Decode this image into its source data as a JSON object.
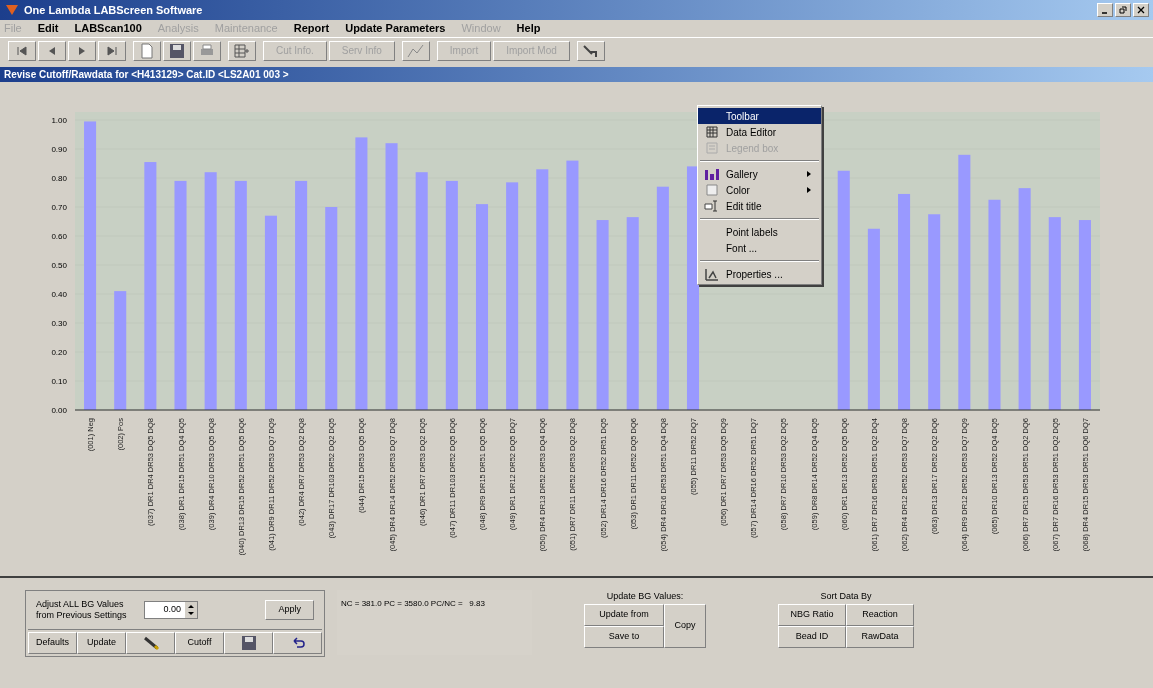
{
  "window": {
    "title": "One Lambda LABScreen Software"
  },
  "menu": [
    {
      "label": "File",
      "disabled": true
    },
    {
      "label": "Edit",
      "disabled": false
    },
    {
      "label": "LABScan100",
      "disabled": false
    },
    {
      "label": "Analysis",
      "disabled": true
    },
    {
      "label": "Maintenance",
      "disabled": true
    },
    {
      "label": "Report",
      "disabled": false
    },
    {
      "label": "Update Parameters",
      "disabled": false
    },
    {
      "label": "Window",
      "disabled": true
    },
    {
      "label": "Help",
      "disabled": false
    }
  ],
  "toolbar": [
    {
      "kind": "first"
    },
    {
      "kind": "prev"
    },
    {
      "kind": "next"
    },
    {
      "kind": "last"
    },
    {
      "kind": "sep"
    },
    {
      "kind": "new"
    },
    {
      "kind": "save"
    },
    {
      "kind": "print"
    },
    {
      "kind": "sep"
    },
    {
      "kind": "grid"
    },
    {
      "kind": "sep"
    },
    {
      "kind": "text",
      "label": "Cut Info.",
      "disabled": true
    },
    {
      "kind": "text",
      "label": "Serv Info",
      "disabled": true
    },
    {
      "kind": "sep"
    },
    {
      "kind": "chart"
    },
    {
      "kind": "sep"
    },
    {
      "kind": "text",
      "label": "Import",
      "disabled": true
    },
    {
      "kind": "text",
      "label": "Import Mod",
      "disabled": true
    },
    {
      "kind": "sep"
    },
    {
      "kind": "tool"
    }
  ],
  "child_window": {
    "title": "Revise Cutoff/Rawdata for <H413129> Cat.ID <LS2A01 003 >"
  },
  "chart_data": {
    "type": "bar",
    "ylim": [
      0,
      1
    ],
    "yticks": [
      {
        "value": 0,
        "label": "0.00"
      },
      {
        "value": 0.1,
        "label": "0.10"
      },
      {
        "value": 0.2,
        "label": "0.20"
      },
      {
        "value": 0.3,
        "label": "0.30"
      },
      {
        "value": 0.4,
        "label": "0.40"
      },
      {
        "value": 0.5,
        "label": "0.50"
      },
      {
        "value": 0.6,
        "label": "0.60"
      },
      {
        "value": 0.7,
        "label": "0.70"
      },
      {
        "value": 0.8,
        "label": "0.80"
      },
      {
        "value": 0.9,
        "label": "0.90"
      },
      {
        "value": 1,
        "label": "1.00"
      }
    ],
    "categories": [
      "(001) Neg",
      "(002) Pos",
      "(037) DR1 DR4 DR53 DQ5 DQ8",
      "(038) DR1 DR15 DR51 DQ4 DQ5",
      "(039) DR4 DR10 DR53 DQ5 DQ8",
      "(040) DR13 DR15 DR52 DR51 DQ5 DQ6",
      "(041) DR9 DR11 DR52 DR53 DQ7 DQ9",
      "(042) DR4 DR7 DR53 DQ2 DQ8",
      "(043) DR17 DR103 DR52 DQ2 DQ5",
      "(044) DR15 DR53 DQ5 DQ6",
      "(045) DR4 DR14 DR52 DR53 DQ7 DQ8",
      "(046) DR1 DR7 DR53 DQ2 DQ5",
      "(047) DR11 DR103 DR52 DQ5 DQ6",
      "(048) DR9 DR15 DR51 DQ5 DQ6",
      "(049) DR1 DR12 DR52 DQ5 DQ7",
      "(050) DR4 DR13 DR52 DR53 DQ4 DQ6",
      "(051) DR7 DR11 DR52 DR53 DQ2 DQ8",
      "(052) DR14 DR16 DR52 DR51 DQ5",
      "(053) DR1 DR11 DR52 DQ5 DQ6",
      "(054) DR4 DR16 DR53 DR51 DQ4 DQ8",
      "(055) DR11 DR52 DQ7",
      "(056) DR1 DR7 DR53 DQ5 DQ9",
      "(057) DR14 DR16 DR52 DR51 DQ7",
      "(058) DR7 DR10 DR53 DQ2 DQ5",
      "(059) DR8 DR14 DR52 DQ4 DQ5",
      "(060) DR1 DR13 DR52 DQ5 DQ6",
      "(061) DR7 DR16 DR53 DR51 DQ2 DQ4",
      "(062) DR4 DR12 DR52 DR53 DQ7 DQ8",
      "(063) DR13 DR17 DR52 DQ2 DQ6",
      "(064) DR9 DR12 DR52 DR53 DQ7 DQ9",
      "(065) DR10 DR13 DR52 DQ4 DQ5",
      "(066) DR7 DR15 DR53 DR51 DQ2 DQ6",
      "(067) DR7 DR16 DR53 DR51 DQ2 DQ5",
      "(068) DR4 DR15 DR53 DR51 DQ6 DQ7"
    ],
    "series": [
      {
        "color": "#9999ff",
        "values": [
          0.995,
          0.41,
          0.855,
          0.79,
          0.82,
          0.79,
          0.67,
          0.79,
          0.7,
          0.94,
          0.92,
          0.82,
          0.79,
          0.71,
          0.785,
          0.83,
          0.86,
          0.655,
          0.665,
          0.77,
          0.84,
          null,
          null,
          null,
          null,
          0.825,
          0.625,
          0.745,
          0.675,
          0.88,
          0.725,
          0.765,
          0.665,
          0.655
        ]
      }
    ]
  },
  "context_menu": [
    {
      "kind": "item",
      "label": "Toolbar",
      "selected": true,
      "disabled": false,
      "submenu": false
    },
    {
      "kind": "item",
      "label": "Data Editor",
      "selected": false,
      "disabled": false,
      "submenu": false
    },
    {
      "kind": "item",
      "label": "Legend box",
      "selected": false,
      "disabled": true,
      "submenu": false
    },
    {
      "kind": "sep"
    },
    {
      "kind": "item",
      "label": "Gallery",
      "selected": false,
      "disabled": false,
      "submenu": true
    },
    {
      "kind": "item",
      "label": "Color",
      "selected": false,
      "disabled": false,
      "submenu": true
    },
    {
      "kind": "item",
      "label": "Edit title",
      "selected": false,
      "disabled": false,
      "submenu": false
    },
    {
      "kind": "sep"
    },
    {
      "kind": "item",
      "label": "Point labels",
      "selected": false,
      "disabled": false,
      "submenu": false
    },
    {
      "kind": "item",
      "label": "Font ...",
      "selected": false,
      "disabled": false,
      "submenu": false
    },
    {
      "kind": "sep"
    },
    {
      "kind": "item",
      "label": "Properties ...",
      "selected": false,
      "disabled": false,
      "submenu": false
    }
  ],
  "adjust": {
    "label": "Adjust ALL BG Values from Previous Settings",
    "value": "0.00",
    "apply": "Apply",
    "buttons": [
      {
        "kind": "text",
        "label": "Defaults"
      },
      {
        "kind": "text",
        "label": "Update"
      },
      {
        "kind": "pen"
      },
      {
        "kind": "text",
        "label": "Cutoff"
      },
      {
        "kind": "save"
      },
      {
        "kind": "undo"
      }
    ]
  },
  "stats": "NC = 381.0 PC = 3580.0 PC/NC =   9.83",
  "update_bg": {
    "title": "Update BG Values:",
    "update_from": "Update from",
    "save_to": "Save to",
    "copy": "Copy"
  },
  "sort": {
    "title": "Sort Data By",
    "buttons": [
      "NBG Ratio",
      "Reaction",
      "Bead ID",
      "RawData"
    ]
  }
}
